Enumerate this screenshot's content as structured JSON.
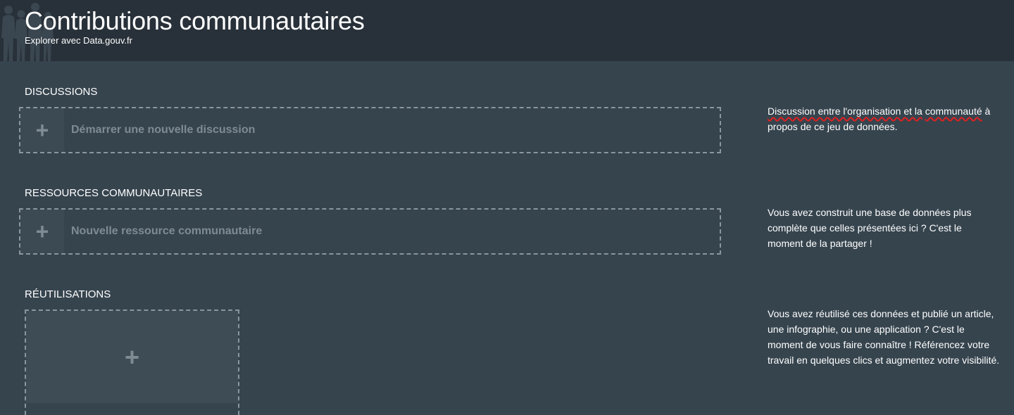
{
  "header": {
    "title": "Contributions communautaires",
    "subtitle": "Explorer avec Data.gouv.fr"
  },
  "sections": {
    "discussions": {
      "title": "DISCUSSIONS",
      "action_label": "Démarrer une nouvelle discussion",
      "plus_icon": "+",
      "description_part1": "Discussion entre l'organisation et la",
      "description_part2": "communauté",
      "description_part3": " à propos de ce jeu de données."
    },
    "community_resources": {
      "title": "RESSOURCES COMMUNAUTAIRES",
      "action_label": "Nouvelle ressource communautaire",
      "plus_icon": "+",
      "description": "Vous avez construit une base de données plus complète que celles présentées ici ? C'est le moment de la partager !"
    },
    "reuses": {
      "title": "RÉUTILISATIONS",
      "plus_icon": "+",
      "description": "Vous avez réutilisé ces données et publié un article, une infographie, ou une application ? C'est le moment de vous faire connaître ! Référencez votre travail en quelques clics et augmentez votre visibilité."
    }
  },
  "colors": {
    "header_bg": "#283139",
    "page_bg": "#36444e",
    "muted_text": "#7f8b93",
    "spellcheck_underline": "#e02020"
  },
  "icons": {
    "header_decoration": "crowd-silhouette-icon",
    "add": "plus-icon"
  }
}
